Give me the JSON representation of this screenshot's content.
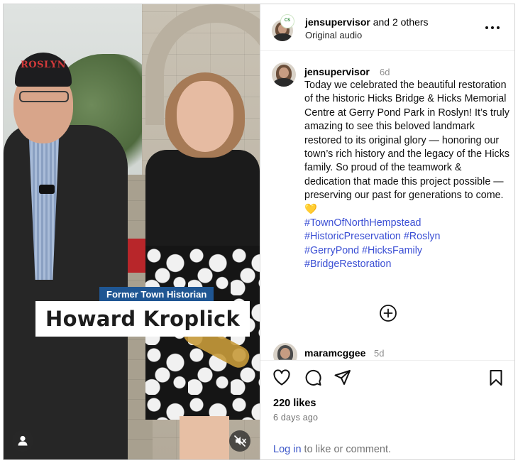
{
  "video": {
    "cap_text": "ROSLYN",
    "caption_title": "Former Town Historian",
    "caption_name": "Howard Kroplick",
    "buttons": [
      "person-icon",
      "speaker-muted-icon"
    ]
  },
  "header": {
    "username": "jensupervisor",
    "collab_suffix": " and 2 others",
    "audio": "Original audio",
    "logo_badge_text": "CS",
    "more_icon": "more-horizontal-icon",
    "more_label": "···"
  },
  "post": {
    "username": "jensupervisor",
    "time": "6d",
    "caption": "Today we celebrated the beautiful restoration of the historic Hicks Bridge & Hicks Memorial Centre at Gerry Pond Park in Roslyn! It’s truly amazing to see this beloved landmark restored to its original glory — honoring our town’s rich history and the legacy of the Hicks family. So proud of the teamwork & dedication that made this project possible — preserving our past for generations to come. 💛",
    "hashtags": [
      "#TownOfNorthHempstead",
      "#HistoricPreservation #Roslyn",
      "#GerryPond #HicksFamily",
      "#BridgeRestoration"
    ]
  },
  "comment": {
    "username": "maramcggee",
    "time": "5d"
  },
  "actions": {
    "icons": [
      "heart-icon",
      "comment-bubble-icon",
      "share-send-icon",
      "bookmark-icon"
    ],
    "likes": "220 likes",
    "posted_ago": "6 days ago",
    "login_link": "Log in",
    "login_suffix": " to like or comment."
  },
  "colors": {
    "link": "#3b4fd4",
    "caption_tag_bg": "#1f5693",
    "muted_text": "#737373"
  }
}
